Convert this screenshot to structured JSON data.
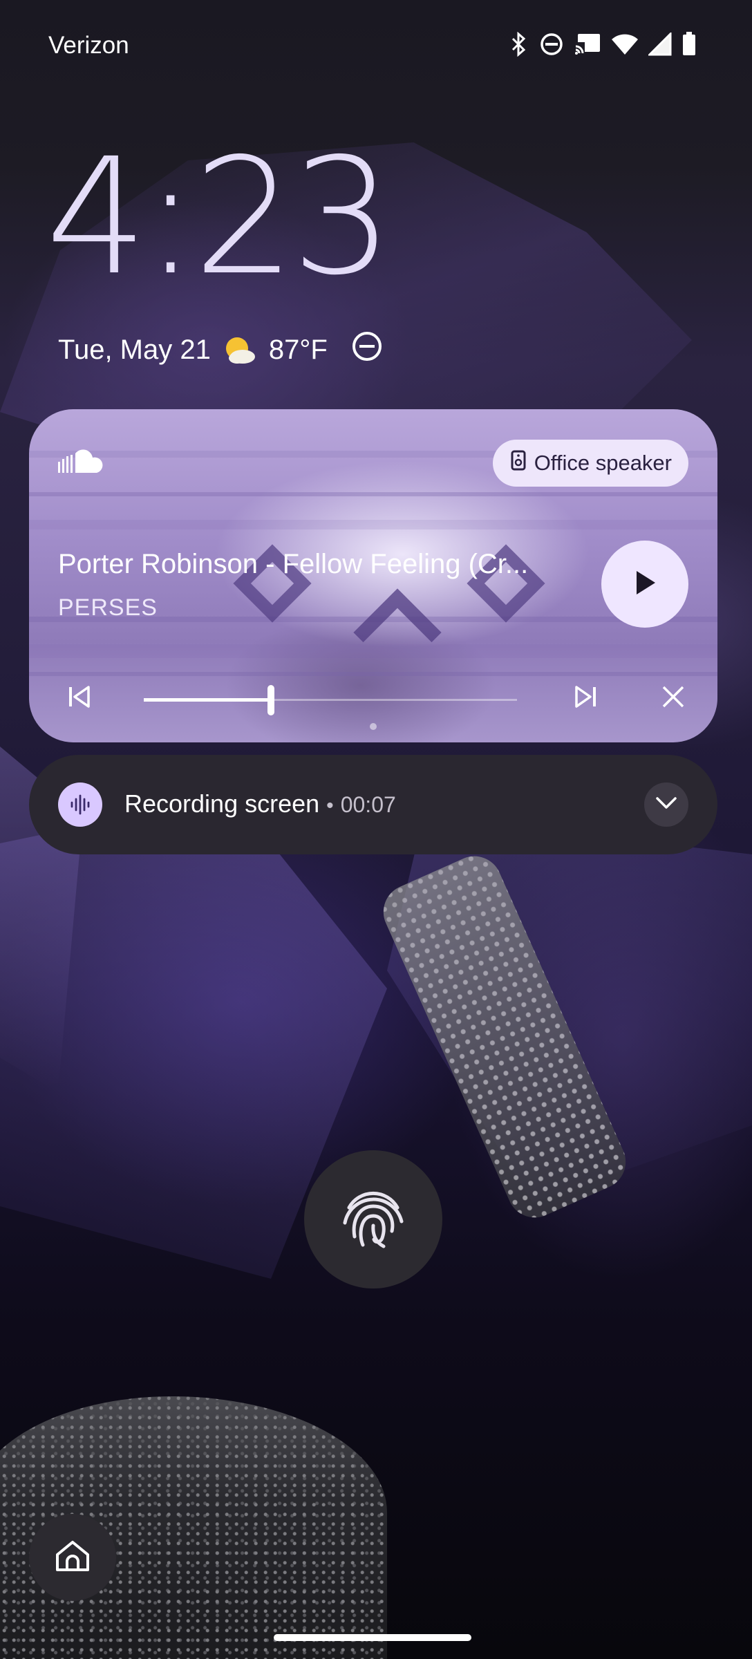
{
  "status_bar": {
    "carrier": "Verizon",
    "icons": [
      "bluetooth-icon",
      "do-not-disturb-icon",
      "cast-icon",
      "wifi-icon",
      "cell-signal-icon",
      "battery-icon"
    ]
  },
  "lockscreen": {
    "time": "4:23",
    "date": "Tue, May 21",
    "weather_icon": "partly-sunny-icon",
    "temperature": "87°F",
    "dnd_icon": "do-not-disturb-icon"
  },
  "media": {
    "app_icon": "soundcloud-icon",
    "output_device": "Office speaker",
    "title": "Porter Robinson - Fellow Feeling (Cr...",
    "artist": "PERSES",
    "progress": 0.34,
    "page_count": 1,
    "colors": {
      "chip_bg": "#eee6fb",
      "play_bg": "#efe6ff"
    }
  },
  "notification": {
    "title": "Recording screen",
    "separator": "•",
    "timer": "00:07",
    "icon": "sound-wave-icon",
    "accent": "#d9c8ff"
  },
  "bottom": {
    "fingerprint_icon": "fingerprint-icon",
    "home_icon": "home-icon"
  }
}
